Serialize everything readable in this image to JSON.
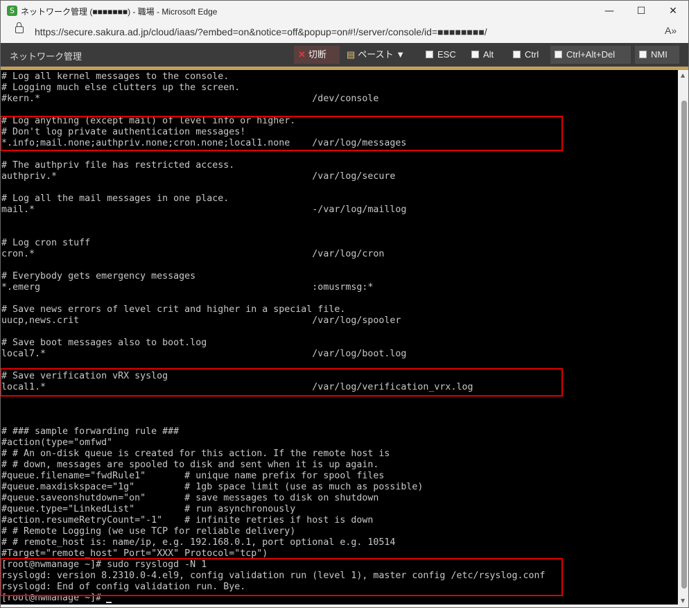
{
  "window": {
    "title": "ネットワーク管理 (■■■■■■■) - 職場 - Microsoft Edge",
    "minimize": "—",
    "maximize": "☐",
    "close": "✕"
  },
  "address_bar": {
    "url": "https://secure.sakura.ad.jp/cloud/iaas/?embed=on&notice=off&popup=on#!/server/console/id=■■■■■■■■/",
    "read_aloud_label": "A»"
  },
  "console_toolbar": {
    "title": "ネットワーク管理",
    "buttons": {
      "cut": "切断",
      "paste": "ペースト ▼",
      "esc": "ESC",
      "alt": "Alt",
      "ctrl": "Ctrl",
      "ctrl_alt_del": "Ctrl+Alt+Del",
      "nmi": "NMI"
    }
  },
  "terminal": {
    "lines": [
      "# Log all kernel messages to the console.",
      "# Logging much else clutters up the screen.",
      "#kern.*                                                 /dev/console",
      "",
      "# Log anything (except mail) of level info or higher.",
      "# Don't log private authentication messages!",
      "*.info;mail.none;authpriv.none;cron.none;local1.none    /var/log/messages",
      "",
      "# The authpriv file has restricted access.",
      "authpriv.*                                              /var/log/secure",
      "",
      "# Log all the mail messages in one place.",
      "mail.*                                                  -/var/log/maillog",
      "",
      "",
      "# Log cron stuff",
      "cron.*                                                  /var/log/cron",
      "",
      "# Everybody gets emergency messages",
      "*.emerg                                                 :omusrmsg:*",
      "",
      "# Save news errors of level crit and higher in a special file.",
      "uucp,news.crit                                          /var/log/spooler",
      "",
      "# Save boot messages also to boot.log",
      "local7.*                                                /var/log/boot.log",
      "",
      "# Save verification vRX syslog",
      "local1.*                                                /var/log/verification_vrx.log",
      "",
      "",
      "",
      "# ### sample forwarding rule ###",
      "#action(type=\"omfwd\"",
      "# # An on-disk queue is created for this action. If the remote host is",
      "# # down, messages are spooled to disk and sent when it is up again.",
      "#queue.filename=\"fwdRule1\"       # unique name prefix for spool files",
      "#queue.maxdiskspace=\"1g\"         # 1gb space limit (use as much as possible)",
      "#queue.saveonshutdown=\"on\"       # save messages to disk on shutdown",
      "#queue.type=\"LinkedList\"         # run asynchronously",
      "#action.resumeRetryCount=\"-1\"    # infinite retries if host is down",
      "# # Remote Logging (we use TCP for reliable delivery)",
      "# # remote_host is: name/ip, e.g. 192.168.0.1, port optional e.g. 10514",
      "#Target=\"remote_host\" Port=\"XXX\" Protocol=\"tcp\")",
      "[root@nwmanage ~]# sudo rsyslogd -N 1",
      "rsyslogd: version 8.2310.0-4.el9, config validation run (level 1), master config /etc/rsyslog.conf",
      "rsyslogd: End of config validation run. Bye.",
      "[root@nwmanage ~]# "
    ]
  },
  "highlight_color": "#e00000"
}
